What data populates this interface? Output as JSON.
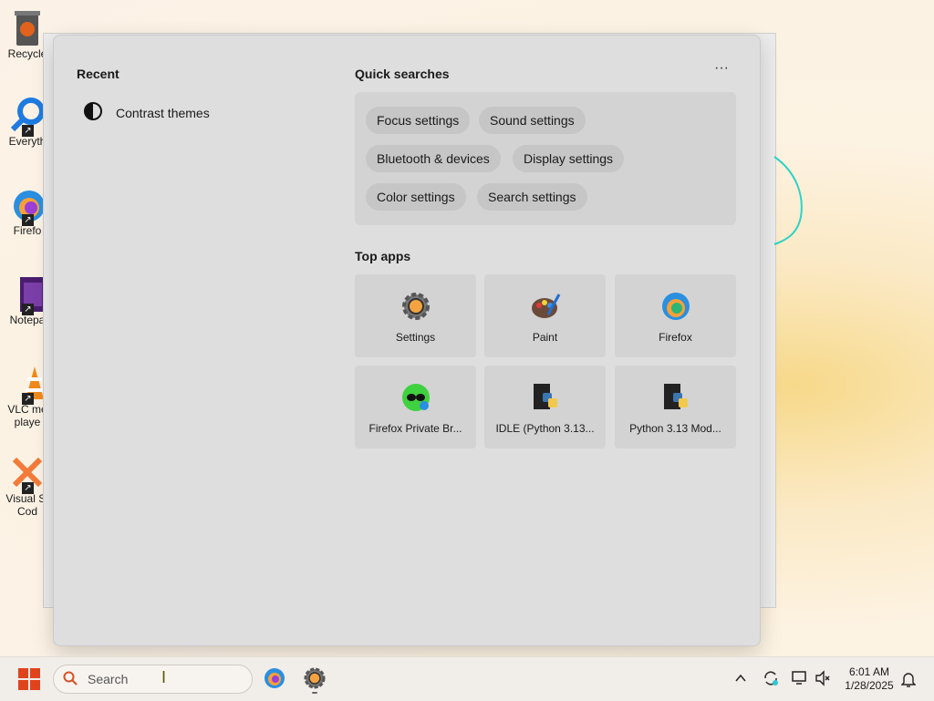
{
  "desktop": {
    "icons": [
      {
        "label": "Recycle",
        "icon": "recycle-bin-icon"
      },
      {
        "label": "Everyth",
        "icon": "everything-search-icon"
      },
      {
        "label": "Firefo",
        "icon": "firefox-icon"
      },
      {
        "label": "Notepa",
        "icon": "notepad-icon"
      },
      {
        "label": "VLC me",
        "label2": "playe",
        "icon": "vlc-icon"
      },
      {
        "label": "Visual St",
        "label2": "Cod",
        "icon": "vscode-icon"
      }
    ]
  },
  "flyout": {
    "recent": {
      "title": "Recent",
      "items": [
        {
          "label": "Contrast themes",
          "icon": "contrast-icon"
        }
      ]
    },
    "quick_searches": {
      "title": "Quick searches",
      "more": "···",
      "chips": [
        "Focus settings",
        "Sound settings",
        "Bluetooth & devices",
        "Display settings",
        "Color settings",
        "Search settings"
      ]
    },
    "top_apps": {
      "title": "Top apps",
      "apps": [
        {
          "name": "Settings",
          "icon": "settings-gear-icon"
        },
        {
          "name": "Paint",
          "icon": "paint-palette-icon"
        },
        {
          "name": "Firefox",
          "icon": "firefox-icon"
        },
        {
          "name": "Firefox Private Br...",
          "icon": "firefox-private-icon"
        },
        {
          "name": "IDLE (Python 3.13...",
          "icon": "python-idle-icon"
        },
        {
          "name": "Python 3.13 Mod...",
          "icon": "python-module-icon"
        }
      ]
    }
  },
  "taskbar": {
    "search_placeholder": "Search",
    "time": "6:01 AM",
    "date": "1/28/2025",
    "start_icon": "windows-start-icon",
    "pinned": [
      "firefox-icon",
      "settings-gear-icon"
    ],
    "tray": [
      "chevron-up-icon",
      "sync-icon",
      "network-icon",
      "volume-muted-icon",
      "notification-bell-icon"
    ]
  },
  "colors": {
    "accent_orange": "#f4a340",
    "windows_red": "#e0431c",
    "flyout_bg": "#dedede",
    "tile_bg": "#d3d3d3"
  }
}
